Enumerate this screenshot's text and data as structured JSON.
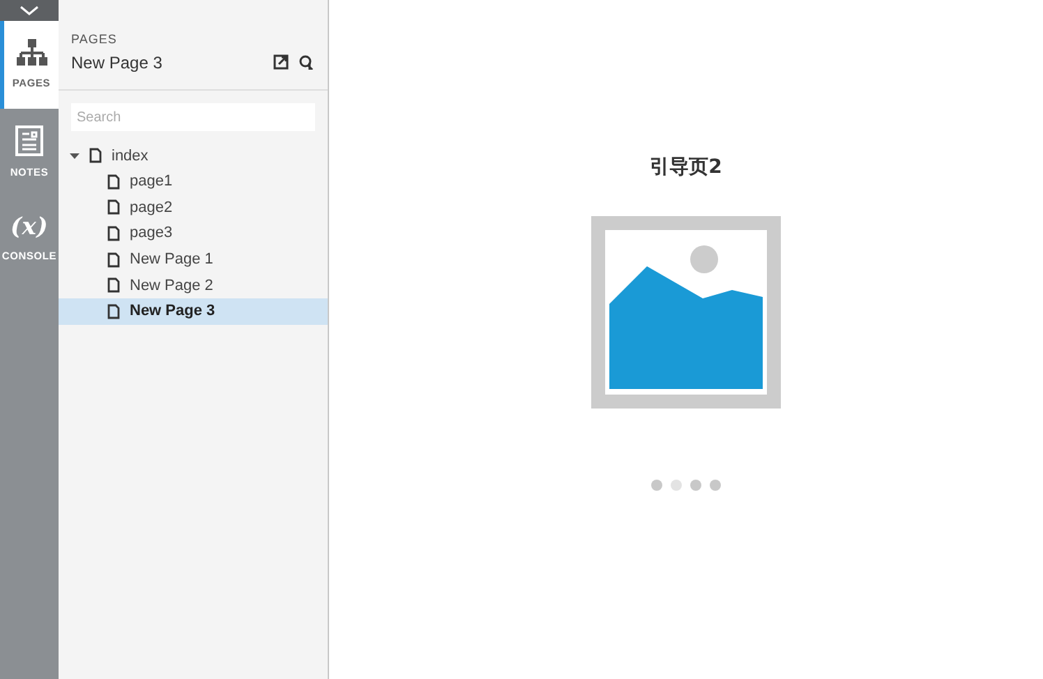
{
  "rail": [
    {
      "label": "PAGES",
      "kind": "pages",
      "selected": true
    },
    {
      "label": "NOTES",
      "kind": "notes",
      "selected": false
    },
    {
      "label": "CONSOLE",
      "kind": "console",
      "glyph": "(x)",
      "selected": false
    }
  ],
  "panel": {
    "heading": "PAGES",
    "title": "New Page 3",
    "search": {
      "placeholder": "Search"
    }
  },
  "tree": [
    {
      "label": "index",
      "expanded": true,
      "selected": false,
      "children": [
        {
          "label": "page1",
          "selected": false
        },
        {
          "label": "page2",
          "selected": false
        },
        {
          "label": "page3",
          "selected": false
        },
        {
          "label": "New Page 1",
          "selected": false
        },
        {
          "label": "New Page 2",
          "selected": false
        },
        {
          "label": "New Page 3",
          "selected": true
        }
      ]
    }
  ],
  "canvas": {
    "title": "引导页2",
    "dots": [
      {
        "selected": false
      },
      {
        "selected": true
      },
      {
        "selected": false
      },
      {
        "selected": false
      }
    ]
  }
}
